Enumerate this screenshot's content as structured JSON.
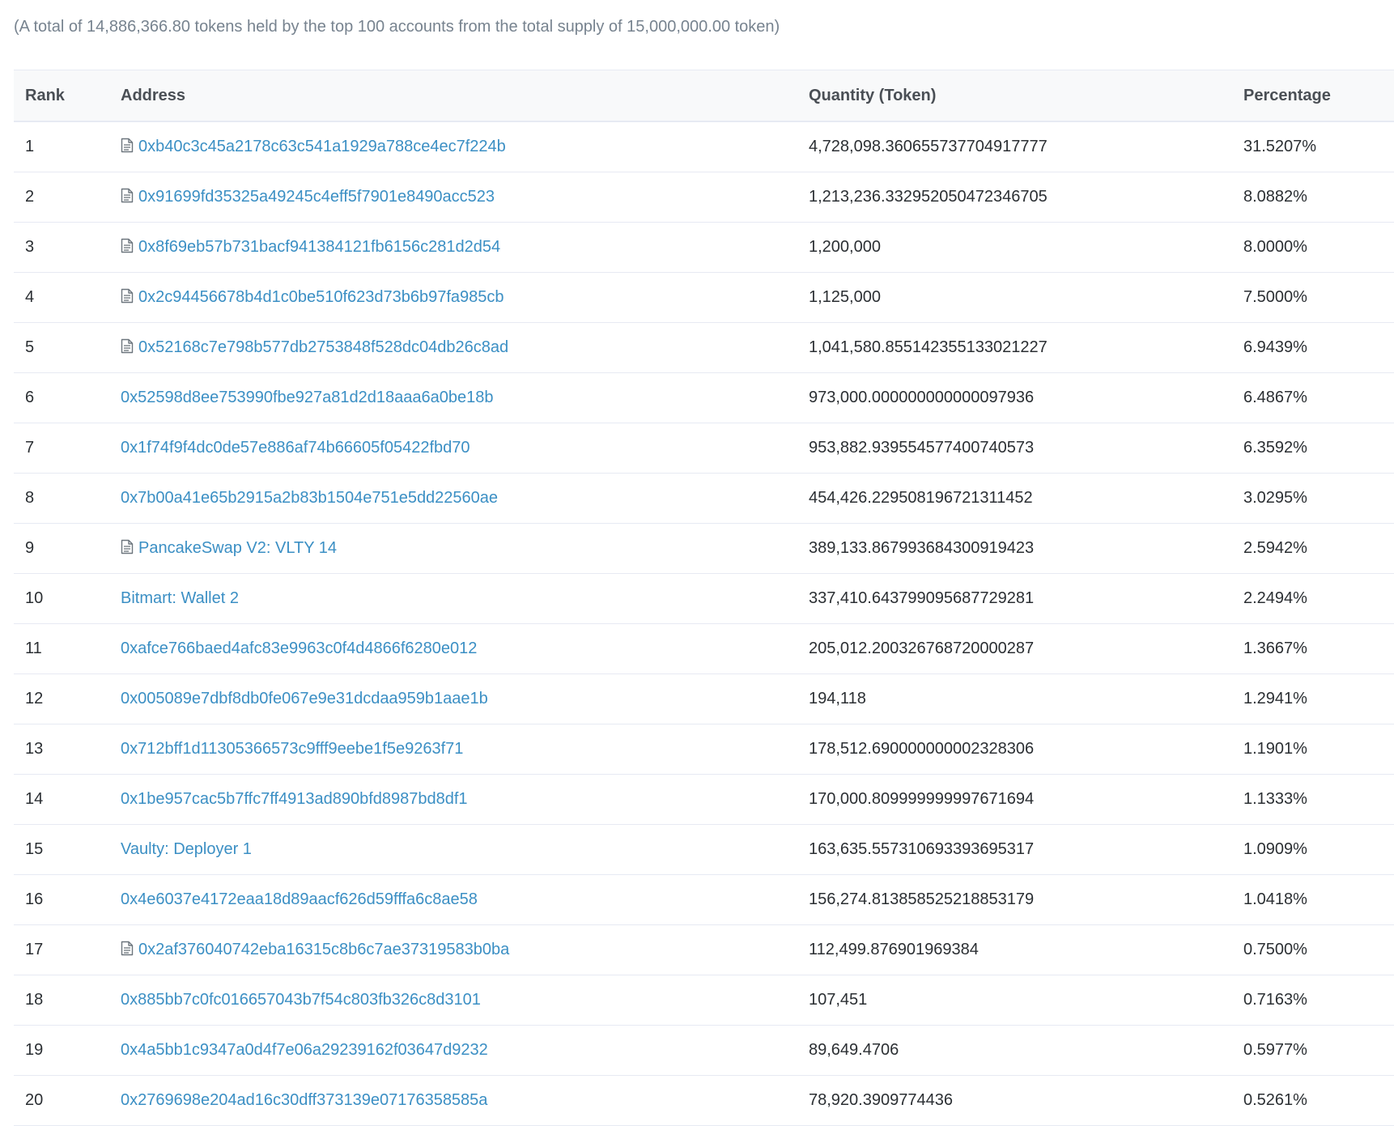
{
  "summary": "(A total of 14,886,366.80 tokens held by the top 100 accounts from the total supply of 15,000,000.00 token)",
  "columns": {
    "rank": "Rank",
    "address": "Address",
    "quantity": "Quantity (Token)",
    "percentage": "Percentage"
  },
  "rows": [
    {
      "rank": "1",
      "address": "0xb40c3c45a2178c63c541a1929a788ce4ec7f224b",
      "contract": true,
      "quantity": "4,728,098.360655737704917777",
      "percentage": "31.5207%"
    },
    {
      "rank": "2",
      "address": "0x91699fd35325a49245c4eff5f7901e8490acc523",
      "contract": true,
      "quantity": "1,213,236.332952050472346705",
      "percentage": "8.0882%"
    },
    {
      "rank": "3",
      "address": "0x8f69eb57b731bacf941384121fb6156c281d2d54",
      "contract": true,
      "quantity": "1,200,000",
      "percentage": "8.0000%"
    },
    {
      "rank": "4",
      "address": "0x2c94456678b4d1c0be510f623d73b6b97fa985cb",
      "contract": true,
      "quantity": "1,125,000",
      "percentage": "7.5000%"
    },
    {
      "rank": "5",
      "address": "0x52168c7e798b577db2753848f528dc04db26c8ad",
      "contract": true,
      "quantity": "1,041,580.855142355133021227",
      "percentage": "6.9439%"
    },
    {
      "rank": "6",
      "address": "0x52598d8ee753990fbe927a81d2d18aaa6a0be18b",
      "contract": false,
      "quantity": "973,000.000000000000097936",
      "percentage": "6.4867%"
    },
    {
      "rank": "7",
      "address": "0x1f74f9f4dc0de57e886af74b66605f05422fbd70",
      "contract": false,
      "quantity": "953,882.939554577400740573",
      "percentage": "6.3592%"
    },
    {
      "rank": "8",
      "address": "0x7b00a41e65b2915a2b83b1504e751e5dd22560ae",
      "contract": false,
      "quantity": "454,426.229508196721311452",
      "percentage": "3.0295%"
    },
    {
      "rank": "9",
      "address": "PancakeSwap V2: VLTY 14",
      "contract": true,
      "quantity": "389,133.867993684300919423",
      "percentage": "2.5942%"
    },
    {
      "rank": "10",
      "address": "Bitmart: Wallet 2",
      "contract": false,
      "quantity": "337,410.643799095687729281",
      "percentage": "2.2494%"
    },
    {
      "rank": "11",
      "address": "0xafce766baed4afc83e9963c0f4d4866f6280e012",
      "contract": false,
      "quantity": "205,012.200326768720000287",
      "percentage": "1.3667%"
    },
    {
      "rank": "12",
      "address": "0x005089e7dbf8db0fe067e9e31dcdaa959b1aae1b",
      "contract": false,
      "quantity": "194,118",
      "percentage": "1.2941%"
    },
    {
      "rank": "13",
      "address": "0x712bff1d11305366573c9fff9eebe1f5e9263f71",
      "contract": false,
      "quantity": "178,512.690000000002328306",
      "percentage": "1.1901%"
    },
    {
      "rank": "14",
      "address": "0x1be957cac5b7ffc7ff4913ad890bfd8987bd8df1",
      "contract": false,
      "quantity": "170,000.809999999997671694",
      "percentage": "1.1333%"
    },
    {
      "rank": "15",
      "address": "Vaulty: Deployer 1",
      "contract": false,
      "quantity": "163,635.557310693393695317",
      "percentage": "1.0909%"
    },
    {
      "rank": "16",
      "address": "0x4e6037e4172eaa18d89aacf626d59fffa6c8ae58",
      "contract": false,
      "quantity": "156,274.813858525218853179",
      "percentage": "1.0418%"
    },
    {
      "rank": "17",
      "address": "0x2af376040742eba16315c8b6c7ae37319583b0ba",
      "contract": true,
      "quantity": "112,499.876901969384",
      "percentage": "0.7500%"
    },
    {
      "rank": "18",
      "address": "0x885bb7c0fc016657043b7f54c803fb326c8d3101",
      "contract": false,
      "quantity": "107,451",
      "percentage": "0.7163%"
    },
    {
      "rank": "19",
      "address": "0x4a5bb1c9347a0d4f7e06a29239162f03647d9232",
      "contract": false,
      "quantity": "89,649.4706",
      "percentage": "0.5977%"
    },
    {
      "rank": "20",
      "address": "0x2769698e204ad16c30dff373139e07176358585a",
      "contract": false,
      "quantity": "78,920.3909774436",
      "percentage": "0.5261%"
    }
  ],
  "icons": {
    "contract": "contract-file-icon"
  },
  "colors": {
    "link": "#3b8fc4",
    "muted": "#77838f",
    "header_bg": "#f8f9fa",
    "border": "#e7eaf3"
  }
}
